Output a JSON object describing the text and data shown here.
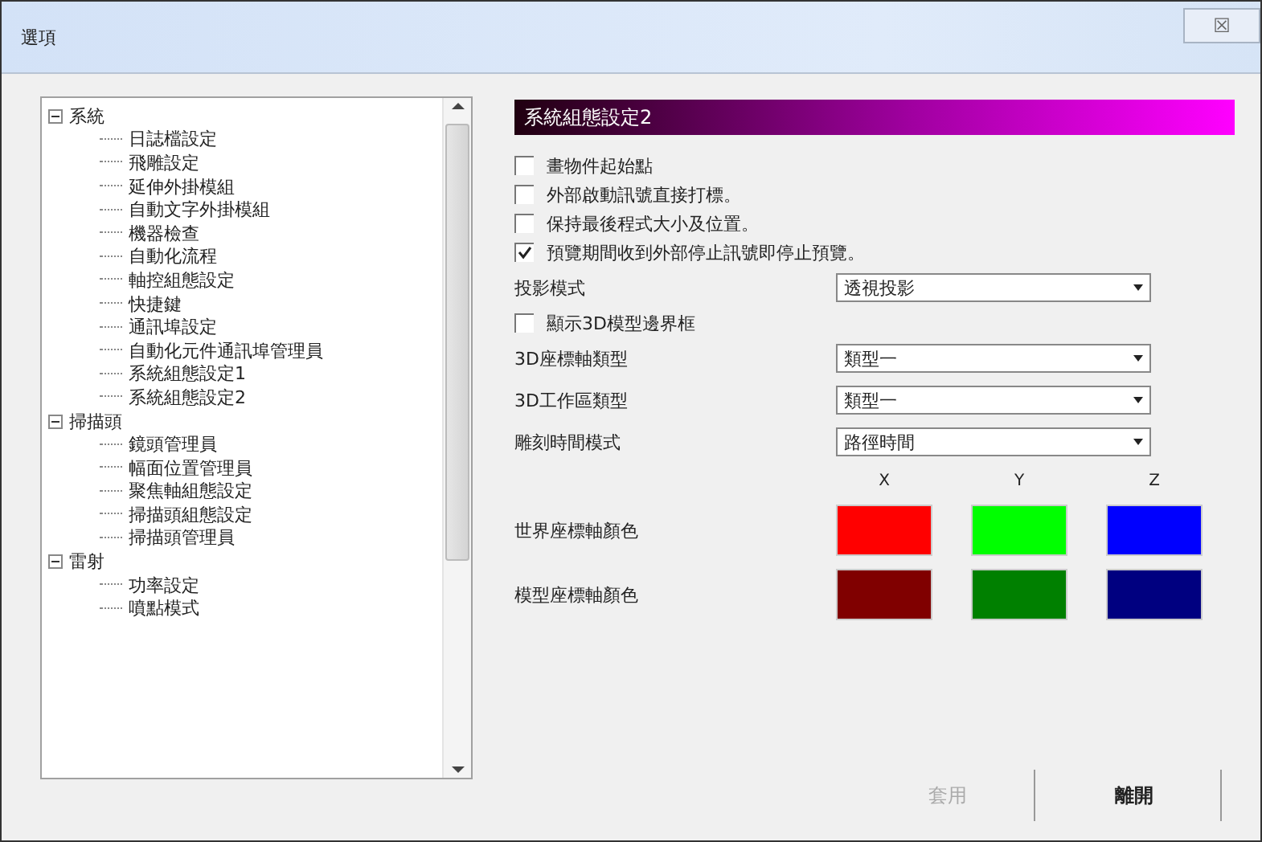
{
  "window": {
    "title": "選項",
    "close": "☒"
  },
  "tree": [
    {
      "label": "系統",
      "expanded": true,
      "children": [
        {
          "label": "日誌檔設定"
        },
        {
          "label": "飛雕設定"
        },
        {
          "label": "延伸外掛模組"
        },
        {
          "label": "自動文字外掛模組"
        },
        {
          "label": "機器檢查"
        },
        {
          "label": "自動化流程"
        },
        {
          "label": "軸控組態設定"
        },
        {
          "label": "快捷鍵"
        },
        {
          "label": "通訊埠設定"
        },
        {
          "label": "自動化元件通訊埠管理員"
        },
        {
          "label": "系統組態設定1"
        },
        {
          "label": "系統組態設定2"
        }
      ]
    },
    {
      "label": "掃描頭",
      "expanded": true,
      "children": [
        {
          "label": "鏡頭管理員"
        },
        {
          "label": "幅面位置管理員"
        },
        {
          "label": "聚焦軸組態設定"
        },
        {
          "label": "掃描頭組態設定"
        },
        {
          "label": "掃描頭管理員"
        }
      ]
    },
    {
      "label": "雷射",
      "expanded": true,
      "children": [
        {
          "label": "功率設定"
        },
        {
          "label": "噴點模式"
        }
      ]
    }
  ],
  "panel": {
    "header": "系統組態設定2",
    "settings": [
      {
        "kind": "checkbox",
        "label": "畫物件起始點",
        "checked": false
      },
      {
        "kind": "checkbox",
        "label": "外部啟動訊號直接打標。",
        "checked": false
      },
      {
        "kind": "checkbox",
        "label": "保持最後程式大小及位置。",
        "checked": false
      },
      {
        "kind": "checkbox",
        "label": "預覽期間收到外部停止訊號即停止預覽。",
        "checked": true
      },
      {
        "kind": "select",
        "label": "投影模式",
        "value": "透視投影"
      },
      {
        "kind": "checkbox",
        "label": "顯示3D模型邊界框",
        "checked": false
      },
      {
        "kind": "select",
        "label": "3D座標軸類型",
        "value": "類型一"
      },
      {
        "kind": "select",
        "label": "3D工作區類型",
        "value": "類型一"
      },
      {
        "kind": "select",
        "label": "雕刻時間模式",
        "value": "路徑時間"
      }
    ],
    "axes": [
      "X",
      "Y",
      "Z"
    ],
    "color_rows": [
      {
        "label": "世界座標軸顏色",
        "swatches": [
          {
            "color": "#ff0000"
          },
          {
            "color": "#00ff00"
          },
          {
            "color": "#0000ff"
          }
        ]
      },
      {
        "label": "模型座標軸顏色",
        "swatches": [
          {
            "color": "#800000"
          },
          {
            "color": "#008000"
          },
          {
            "color": "#000080"
          }
        ]
      }
    ]
  },
  "buttons": [
    {
      "label": "套用",
      "disabled": true
    },
    {
      "label": "離開",
      "disabled": false
    }
  ]
}
